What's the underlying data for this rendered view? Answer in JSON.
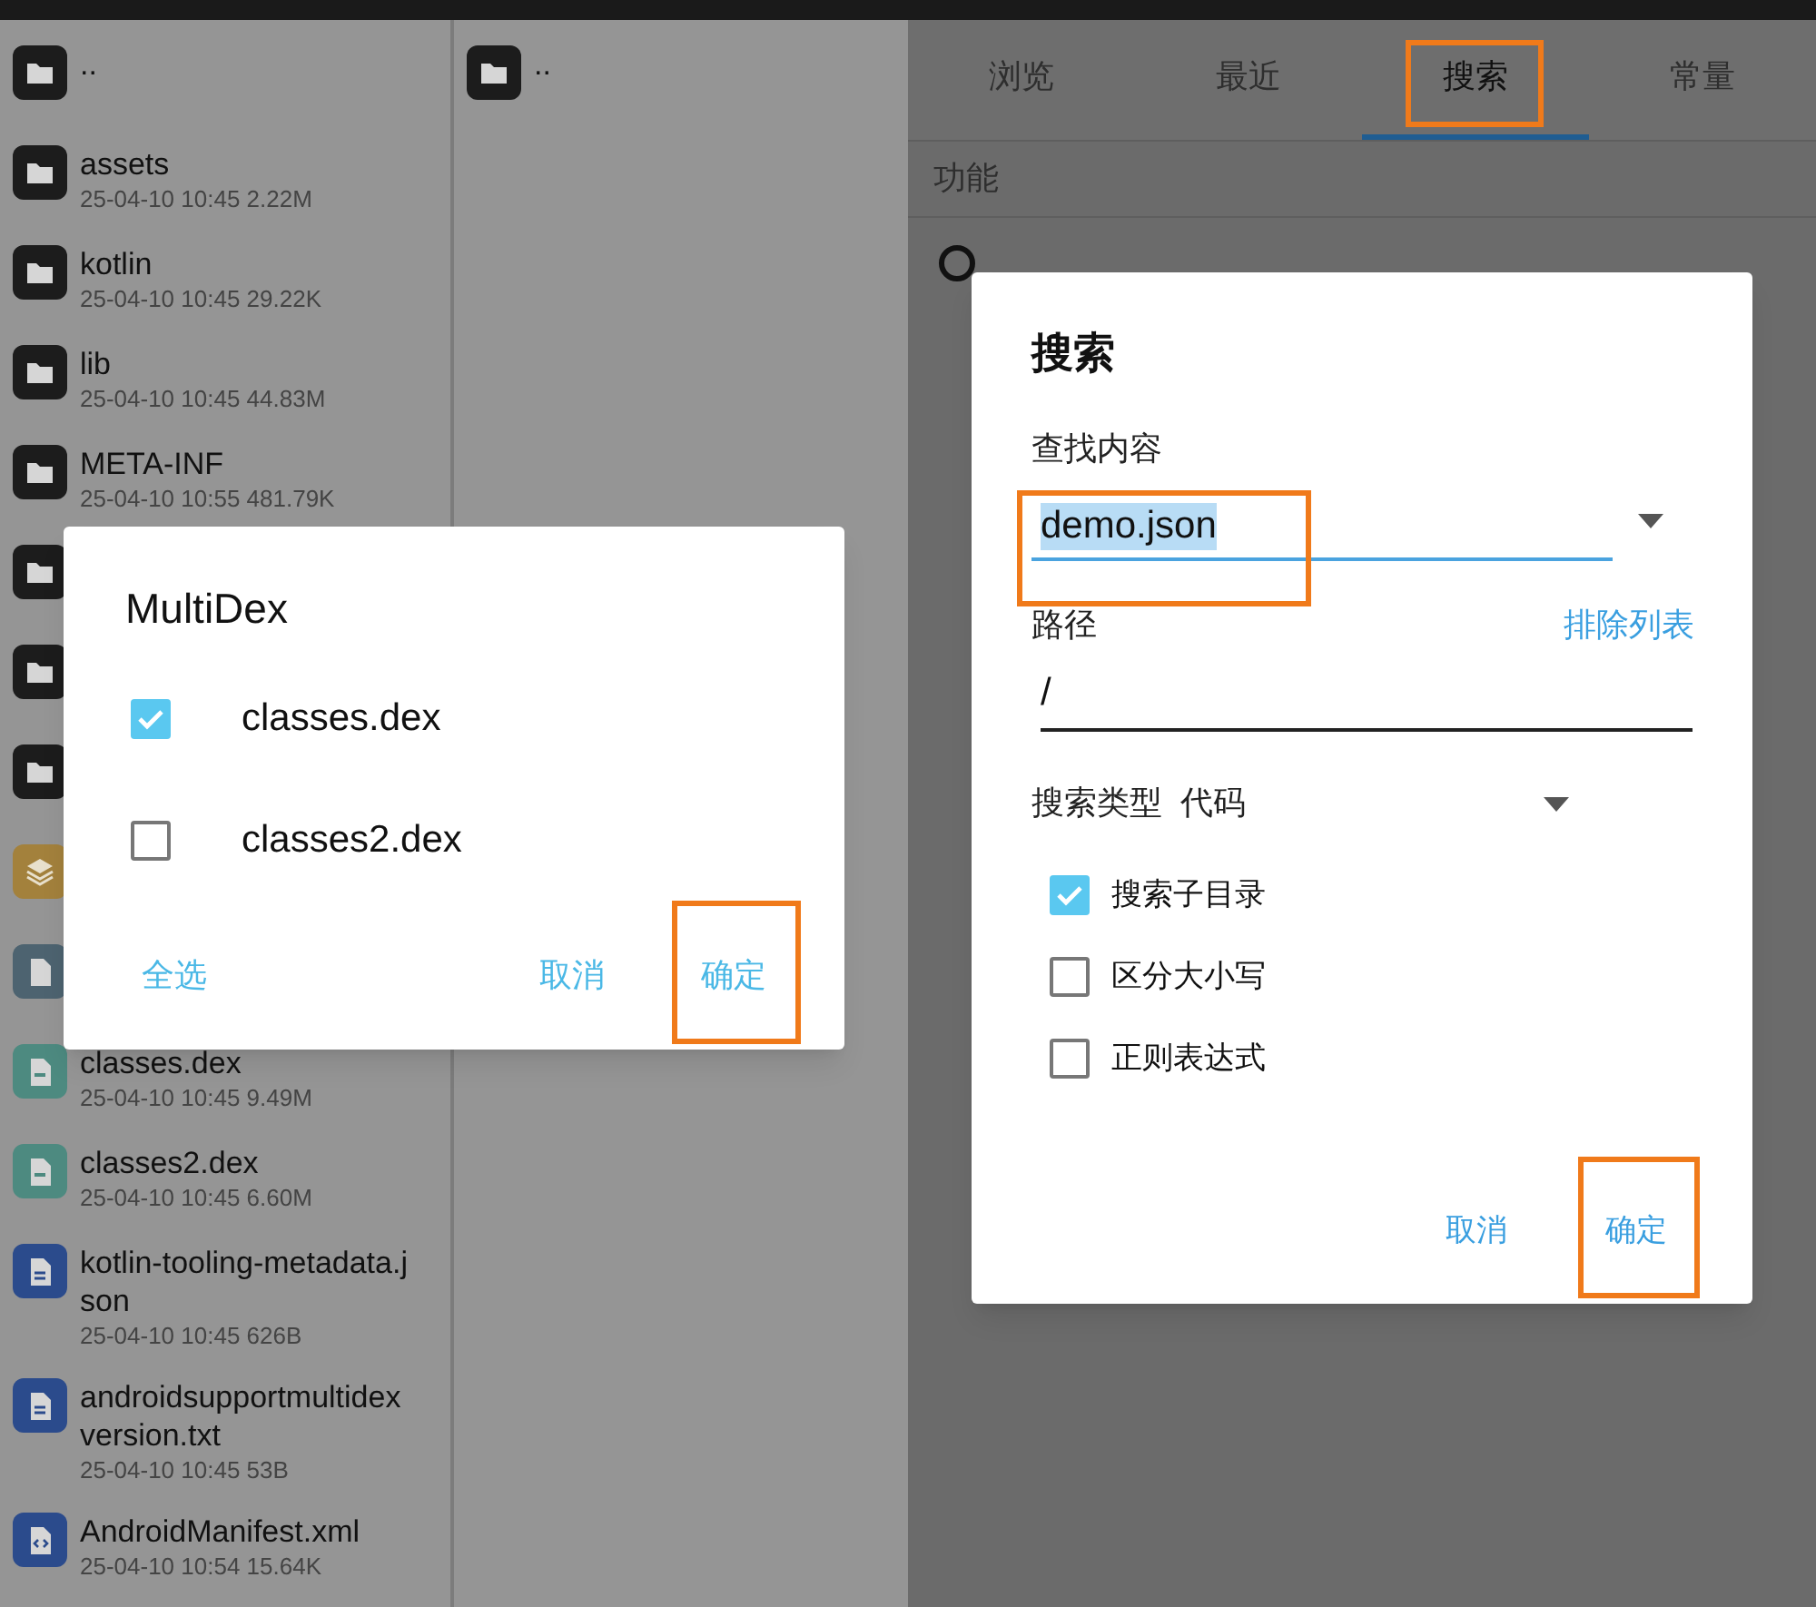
{
  "left_panel": {
    "files": [
      {
        "kind": "folder",
        "name": ".."
      },
      {
        "kind": "folder",
        "name": "assets",
        "meta": "25-04-10 10:45  2.22M"
      },
      {
        "kind": "folder",
        "name": "kotlin",
        "meta": "25-04-10 10:45  29.22K"
      },
      {
        "kind": "folder",
        "name": "lib",
        "meta": "25-04-10 10:45  44.83M"
      },
      {
        "kind": "folder",
        "name": "META-INF",
        "meta": "25-04-10 10:55  481.79K"
      },
      {
        "kind": "folder"
      },
      {
        "kind": "folder"
      },
      {
        "kind": "folder"
      },
      {
        "kind": "layers"
      },
      {
        "kind": "doc"
      },
      {
        "kind": "dex",
        "name": "classes.dex",
        "meta": "25-04-10 10:45  9.49M"
      },
      {
        "kind": "dex",
        "name": "classes2.dex",
        "meta": "25-04-10 10:45  6.60M"
      },
      {
        "kind": "text",
        "name": "kotlin-tooling-metadata.json",
        "meta": "25-04-10 10:45  626B"
      },
      {
        "kind": "text",
        "name": "androidsupportmultidexversion.txt",
        "meta": "25-04-10 10:45  53B"
      },
      {
        "kind": "xml",
        "name": "AndroidManifest.xml",
        "meta": "25-04-10 10:54  15.64K"
      }
    ]
  },
  "middle_panel": {
    "files": [
      {
        "kind": "folder",
        "name": ".."
      }
    ]
  },
  "multidex_dialog": {
    "title": "MultiDex",
    "options": [
      {
        "label": "classes.dex",
        "checked": true
      },
      {
        "label": "classes2.dex",
        "checked": false
      }
    ],
    "buttons": [
      {
        "label": "全选",
        "highlighted": false
      },
      {
        "label": "取消",
        "highlighted": false
      },
      {
        "label": "确定",
        "highlighted": true
      }
    ]
  },
  "search_screen": {
    "tabs": [
      {
        "label": "浏览",
        "selected": false,
        "highlighted": false
      },
      {
        "label": "最近",
        "selected": false,
        "highlighted": false
      },
      {
        "label": "搜索",
        "selected": true,
        "highlighted": true
      },
      {
        "label": "常量",
        "selected": false,
        "highlighted": false
      }
    ],
    "section": "功能",
    "items": [
      {
        "kind": "radio"
      }
    ]
  },
  "search_dialog": {
    "title": "搜索",
    "find": {
      "label": "查找内容",
      "value": "demo.json",
      "highlighted": true
    },
    "path": {
      "label": "路径",
      "link": "排除列表",
      "value": "/"
    },
    "type": {
      "label": "搜索类型",
      "value": "代码"
    },
    "options": [
      {
        "label": "搜索子目录",
        "checked": true
      },
      {
        "label": "区分大小写",
        "checked": false
      },
      {
        "label": "正则表达式",
        "checked": false
      }
    ],
    "buttons": [
      {
        "label": "取消",
        "highlighted": false
      },
      {
        "label": "确定",
        "highlighted": true
      }
    ]
  }
}
